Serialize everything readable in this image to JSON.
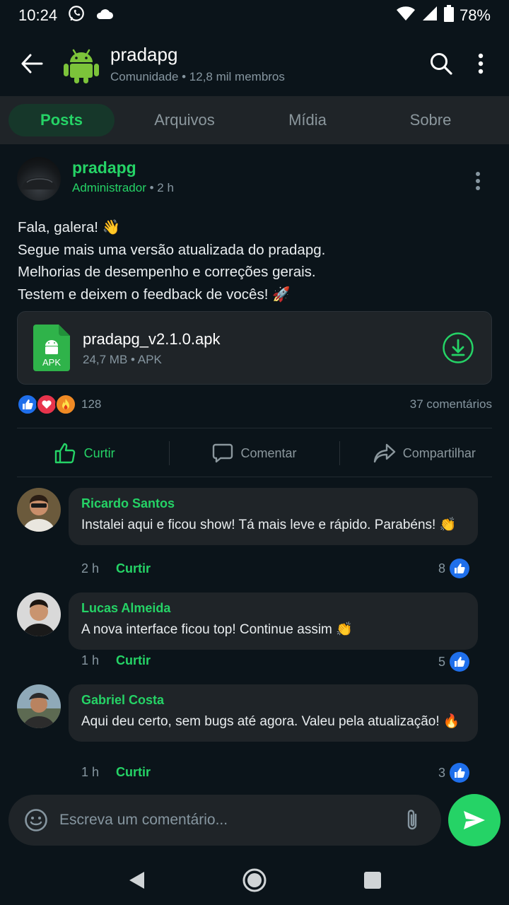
{
  "status": {
    "time": "10:24",
    "battery": "78%"
  },
  "header": {
    "title": "pradapg",
    "subtitle": "Comunidade • 12,8 mil membros"
  },
  "tabs": [
    {
      "label": "Posts",
      "active": true
    },
    {
      "label": "Arquivos",
      "active": false
    },
    {
      "label": "Mídia",
      "active": false
    },
    {
      "label": "Sobre",
      "active": false
    }
  ],
  "post": {
    "author": "pradapg",
    "role": "Administrador",
    "time": "• 2 h",
    "lines": [
      "Fala, galera! 👋",
      "Segue mais uma versão atualizada do pradapg.",
      "Melhorias de desempenho e correções gerais.",
      "Testem e deixem o feedback de vocês! 🚀"
    ],
    "file": {
      "name": "pradapg_v2.1.0.apk",
      "meta": "24,7 MB • APK",
      "badge": "APK"
    },
    "reaction_count": "128",
    "comments_count": "37 comentários",
    "actions": {
      "like": "Curtir",
      "comment": "Comentar",
      "share": "Compartilhar"
    }
  },
  "comments": [
    {
      "name": "Ricardo Santos",
      "text": "Instalei aqui e ficou show! Tá mais leve e rápido. Parabéns! 👏",
      "time": "2 h",
      "like_label": "Curtir",
      "likes": "8"
    },
    {
      "name": "Lucas Almeida",
      "text": "A nova interface ficou top! Continue assim 👏",
      "time": "1 h",
      "like_label": "Curtir",
      "likes": "5"
    },
    {
      "name": "Gabriel Costa",
      "text": "Aqui deu certo, sem bugs até agora. Valeu pela atualização! 🔥",
      "time": "1 h",
      "like_label": "Curtir",
      "likes": "3"
    }
  ],
  "composer": {
    "placeholder": "Escreva um comentário..."
  },
  "colors": {
    "accent": "#25d366",
    "background": "#0b141a",
    "surface": "#1f2428",
    "like_blue": "#1f6feb"
  }
}
